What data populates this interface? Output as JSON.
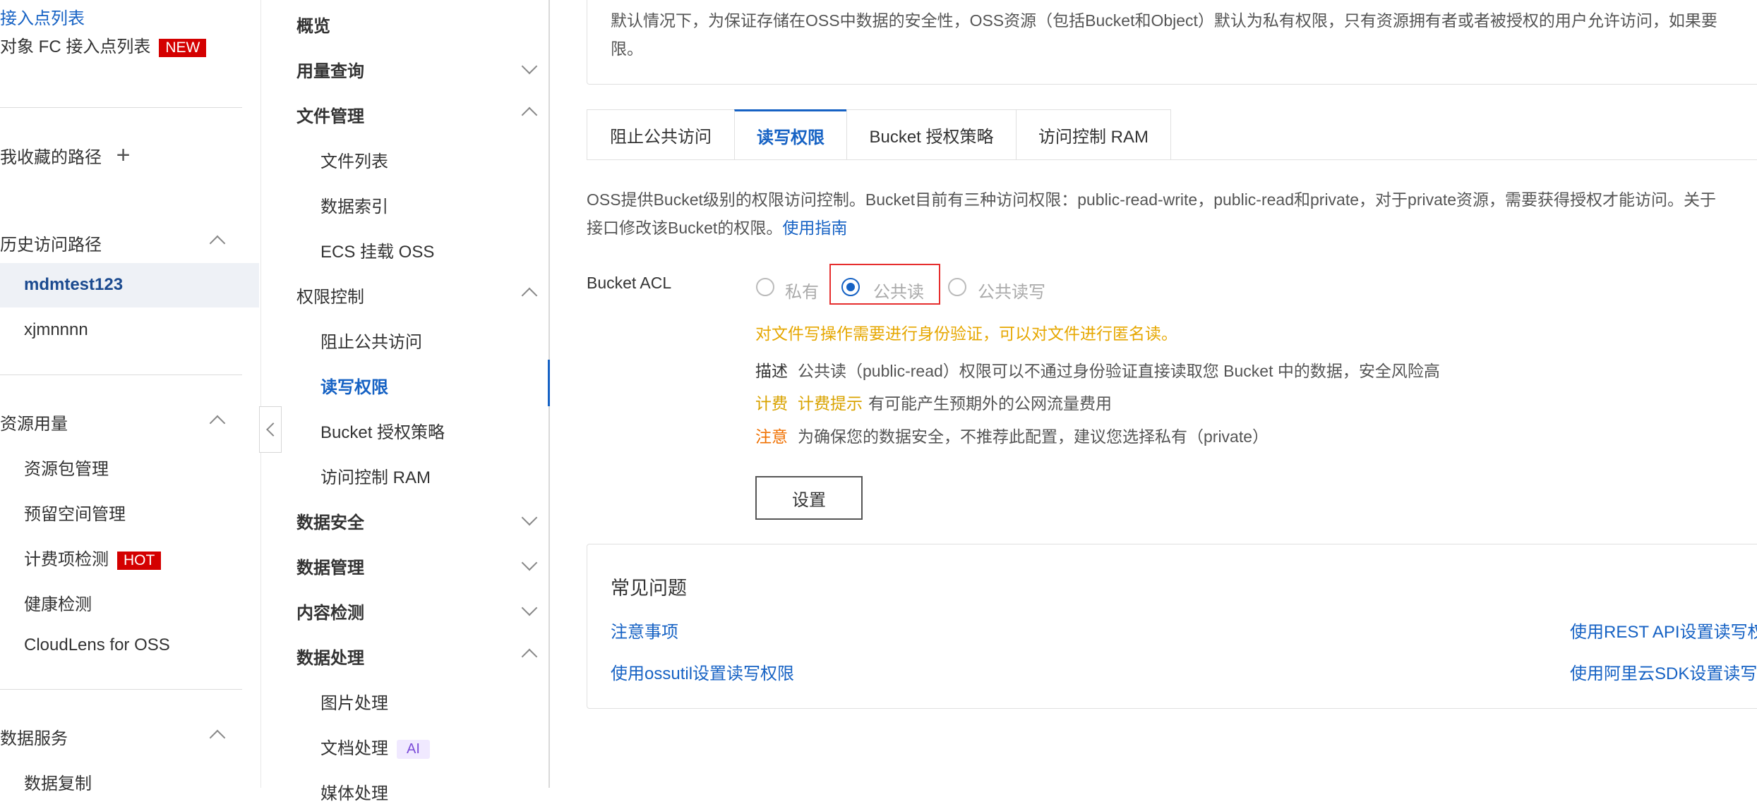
{
  "sidebar": {
    "endpoints": "接入点列表",
    "fc_endpoints": "对象 FC 接入点列表",
    "new_badge": "NEW",
    "favorites": "我收藏的路径",
    "favorites_add": "+",
    "history": "历史访问路径",
    "history_items": [
      "mdmtest123",
      "xjmnnnn"
    ],
    "usage": "资源用量",
    "usage_items": [
      "资源包管理",
      "预留空间管理",
      "计费项检测",
      "健康检测",
      "CloudLens for OSS"
    ],
    "hot_badge": "HOT",
    "data_service": "数据服务",
    "data_service_items": [
      "数据复制"
    ]
  },
  "nav": {
    "overview": "概览",
    "usage_query": "用量查询",
    "file_mgmt": "文件管理",
    "file_items": [
      "文件列表",
      "数据索引",
      "ECS 挂载 OSS"
    ],
    "access_ctrl": "权限控制",
    "access_items": [
      "阻止公共访问",
      "读写权限",
      "Bucket 授权策略",
      "访问控制 RAM"
    ],
    "data_security": "数据安全",
    "data_mgmt": "数据管理",
    "content_check": "内容检测",
    "data_process": "数据处理",
    "process_items": [
      "图片处理",
      "文档处理",
      "媒体处理"
    ],
    "ai_tag": "AI"
  },
  "main": {
    "info_text": "默认情况下，为保证存储在OSS中数据的安全性，OSS资源（包括Bucket和Object）默认为私有权限，只有资源拥有者或者被授权的用户允许访问，如果要",
    "info_text2": "限。",
    "tabs": [
      "阻止公共访问",
      "读写权限",
      "Bucket 授权策略",
      "访问控制 RAM"
    ],
    "desc_line1": "OSS提供Bucket级别的权限访问控制。Bucket目前有三种访问权限：public-read-write，public-read和private，对于private资源，需要获得授权才能访问。关于",
    "desc_line2": "接口修改该Bucket的权限。",
    "guide_link": "使用指南",
    "acl_label": "Bucket ACL",
    "acl_options": [
      "私有",
      "公共读",
      "公共读写"
    ],
    "warning": "对文件写操作需要进行身份验证，可以对文件进行匿名读。",
    "describe_key": "描述",
    "describe_val": "公共读（public-read）权限可以不通过身份验证直接读取您 Bucket 中的数据，安全风险高",
    "fee_key": "计费",
    "fee_hint": "计费提示",
    "fee_val": "有可能产生预期外的公网流量费用",
    "note_key": "注意",
    "note_val": "为确保您的数据安全，不推荐此配置，建议您选择私有（private）",
    "set_button": "设置",
    "faq_title": "常见问题",
    "faq_links": [
      "注意事项",
      "使用ossutil设置读写权限",
      "使用REST API设置读写权",
      "使用阿里云SDK设置读写"
    ]
  }
}
